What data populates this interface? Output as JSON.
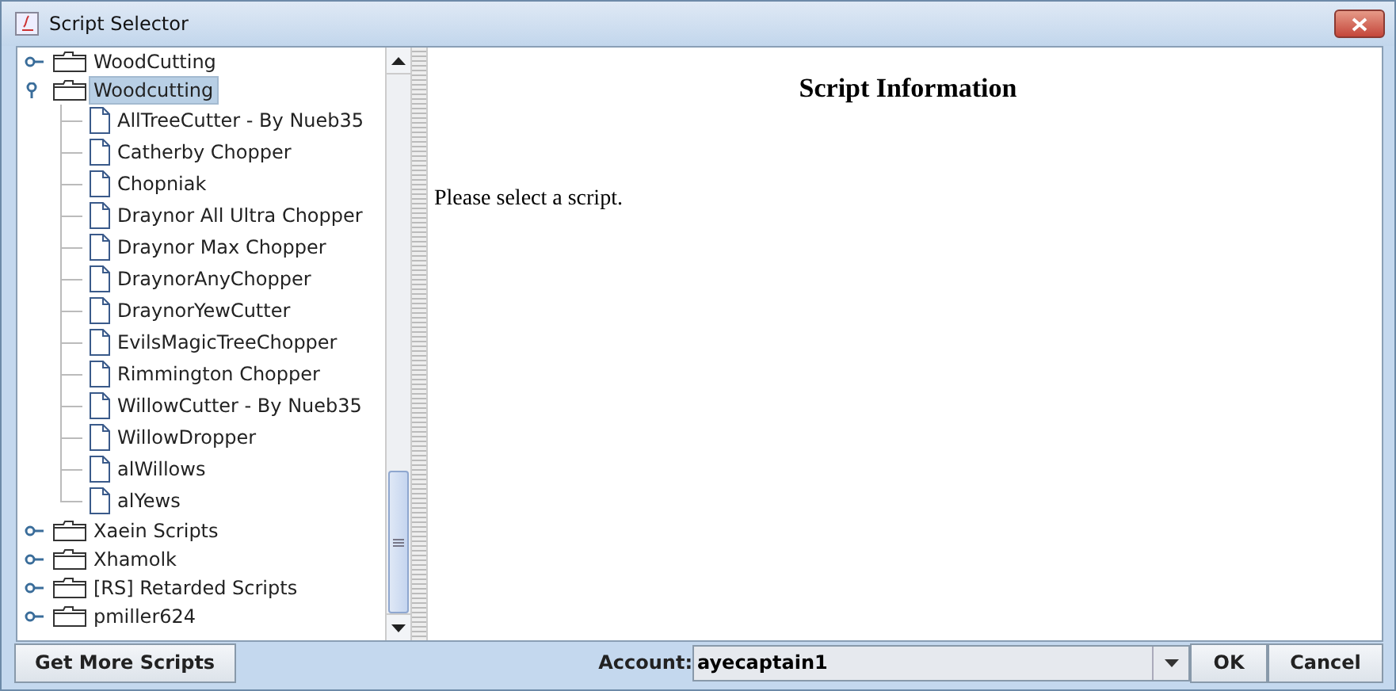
{
  "window": {
    "title": "Script Selector"
  },
  "tree": [
    {
      "label": "WoodCutting",
      "kind": "folder",
      "expanded": false,
      "selected": false
    },
    {
      "label": "Woodcutting",
      "kind": "folder",
      "expanded": true,
      "selected": true,
      "children": [
        {
          "label": "AllTreeCutter - By Nueb35",
          "kind": "script",
          "selected": false
        },
        {
          "label": "Catherby Chopper",
          "kind": "script",
          "selected": false
        },
        {
          "label": "Chopniak",
          "kind": "script",
          "selected": false
        },
        {
          "label": "Draynor All Ultra Chopper",
          "kind": "script",
          "selected": false
        },
        {
          "label": "Draynor Max Chopper",
          "kind": "script",
          "selected": false
        },
        {
          "label": "DraynorAnyChopper",
          "kind": "script",
          "selected": false
        },
        {
          "label": "DraynorYewCutter",
          "kind": "script",
          "selected": false
        },
        {
          "label": "EvilsMagicTreeChopper",
          "kind": "script",
          "selected": false
        },
        {
          "label": "Rimmington Chopper",
          "kind": "script",
          "selected": false
        },
        {
          "label": "WillowCutter - By Nueb35",
          "kind": "script",
          "selected": false
        },
        {
          "label": "WillowDropper",
          "kind": "script",
          "selected": false
        },
        {
          "label": "alWillows",
          "kind": "script",
          "selected": false
        },
        {
          "label": "alYews",
          "kind": "script",
          "selected": false
        }
      ]
    },
    {
      "label": "Xaein Scripts",
      "kind": "folder",
      "expanded": false,
      "selected": false
    },
    {
      "label": "Xhamolk",
      "kind": "folder",
      "expanded": false,
      "selected": false
    },
    {
      "label": "[RS] Retarded Scripts",
      "kind": "folder",
      "expanded": false,
      "selected": false
    },
    {
      "label": "pmiller624",
      "kind": "folder",
      "expanded": false,
      "selected": false
    }
  ],
  "info": {
    "heading": "Script Information",
    "message": "Please select a script."
  },
  "footer": {
    "more_button": "Get More Scripts",
    "account_label": "Account:",
    "account_value": "ayecaptain1",
    "ok_button": "OK",
    "cancel_button": "Cancel"
  }
}
